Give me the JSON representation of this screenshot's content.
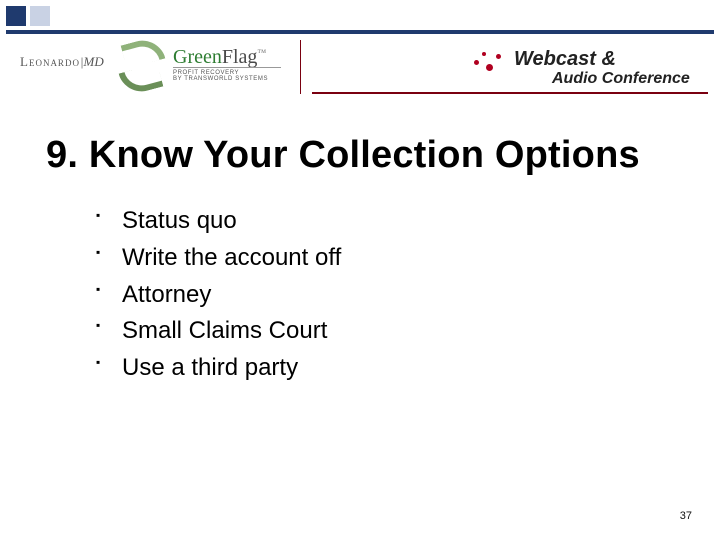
{
  "header": {
    "leonardo": "Leonardo",
    "leonardo_suffix": "|MD",
    "greenflag_green": "Green",
    "greenflag_flag": "Flag",
    "greenflag_tm": "™",
    "greenflag_sub": "PROFIT RECOVERY",
    "greenflag_sub2": "BY TRANSWORLD SYSTEMS",
    "webcast_line1_a": "Webcast",
    "webcast_amp": "&",
    "webcast_line2": "Audio Conference"
  },
  "title": "9. Know Your Collection Options",
  "bullets": [
    "Status quo",
    "Write the account off",
    "Attorney",
    "Small Claims Court",
    "Use a third party"
  ],
  "page_number": "37"
}
